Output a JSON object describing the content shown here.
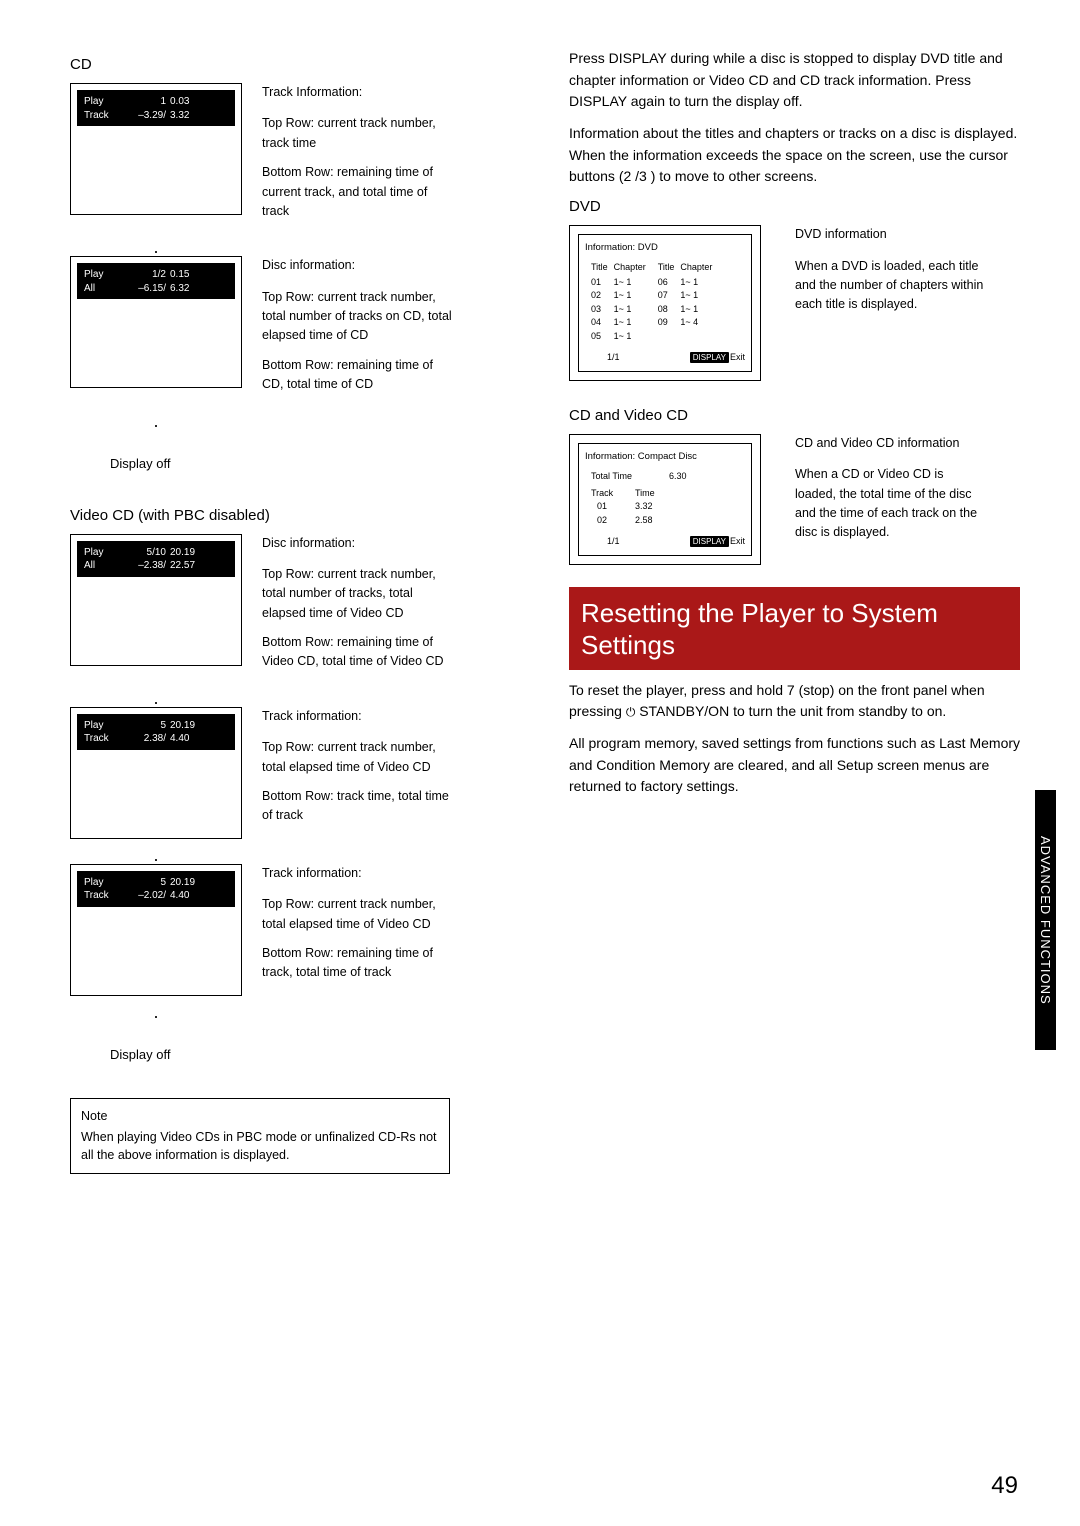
{
  "left": {
    "cd_label": "CD",
    "d1": {
      "row1": {
        "l": "Play",
        "m": "1",
        "r": "0.03"
      },
      "row2": {
        "l": "Track",
        "m": "–3.29/",
        "r": "3.32"
      },
      "title": "Track Information:",
      "top_label": "Top Row:",
      "top_text": "current track number, track time",
      "bot_label": "Bottom Row:",
      "bot_text": "remaining time of current track, and total time of track"
    },
    "d2": {
      "row1": {
        "l": "Play",
        "m": "1/2",
        "r": "0.15"
      },
      "row2": {
        "l": "All",
        "m": "–6.15/",
        "r": "6.32"
      },
      "title": "Disc information:",
      "top_label": "Top Row:",
      "top_text": "current track number, total number of tracks on CD, total elapsed time of CD",
      "bot_label": "Bottom Row:",
      "bot_text": "remaining time of CD, total time of CD"
    },
    "display_off": "Display off",
    "vcd_label": "Video CD (with PBC disabled)",
    "d3": {
      "row1": {
        "l": "Play",
        "m": "5/10",
        "r": "20.19"
      },
      "row2": {
        "l": "All",
        "m": "–2.38/",
        "r": "22.57"
      },
      "title": "Disc information:",
      "top_label": "Top Row:",
      "top_text": "current track number, total number of tracks, total elapsed time of Video CD",
      "bot_label": "Bottom Row:",
      "bot_text": "remaining time of Video CD, total time of Video CD"
    },
    "d4": {
      "row1": {
        "l": "Play",
        "m": "5",
        "r": "20.19"
      },
      "row2": {
        "l": "Track",
        "m": "2.38/",
        "r": "4.40"
      },
      "title": "Track information:",
      "top_label": "Top Row:",
      "top_text": "current track number, total elapsed time of Video CD",
      "bot_label": "Bottom Row:",
      "bot_text": "track time, total time of track"
    },
    "d5": {
      "row1": {
        "l": "Play",
        "m": "5",
        "r": "20.19"
      },
      "row2": {
        "l": "Track",
        "m": "–2.02/",
        "r": "4.40"
      },
      "title": "Track information:",
      "top_label": "Top Row:",
      "top_text": "current track number, total elapsed time of Video CD",
      "bot_label": "Bottom Row:",
      "bot_text": "remaining time of track, total time of track"
    },
    "note_title": "Note",
    "note_body": "When playing Video CDs in PBC mode or unfinalized CD-Rs not all the above information is displayed."
  },
  "right": {
    "p1": "Press DISPLAY during while a disc is stopped to display DVD title and chapter information or Video CD and CD track information. Press DISPLAY again to turn the display off.",
    "p2a": "Information about the titles and chapters or tracks on a disc is displayed. When the information exceeds the space on the screen, use the ",
    "p2b": "cursor buttons",
    "p2c": " (2 /3 ) to move to other screens.",
    "dvd_label": "DVD",
    "dvd_info": {
      "header": "Information: DVD",
      "cols": [
        "Title",
        "Chapter",
        "Title",
        "Chapter"
      ],
      "data_left_titles": [
        "01",
        "02",
        "03",
        "04",
        "05"
      ],
      "data_left_ch": [
        "1~ 1",
        "1~ 1",
        "1~ 1",
        "1~ 1",
        "1~ 1"
      ],
      "data_right_titles": [
        "06",
        "07",
        "08",
        "09"
      ],
      "data_right_ch": [
        "1~ 1",
        "1~ 1",
        "1~ 1",
        "1~ 4"
      ],
      "page": "1/1",
      "display_label": "DISPLAY",
      "exit_label": "Exit",
      "side_title": "DVD information",
      "side_body": "When a DVD is loaded, each title and the number of chapters within each title is displayed."
    },
    "cdvcd_label": "CD and Video CD",
    "cd_info": {
      "header": "Information: Compact Disc",
      "total_label": "Total Time",
      "total_value": "6.30",
      "track_label": "Track",
      "time_label": "Time",
      "tracks": [
        [
          "01",
          "3.32"
        ],
        [
          "02",
          "2.58"
        ]
      ],
      "page": "1/1",
      "display_label": "DISPLAY",
      "exit_label": "Exit",
      "side_title": "CD and Video CD information",
      "side_body": "When a CD or Video CD is loaded, the total time of the disc and the time of each track on the disc  is displayed."
    },
    "banner": "Resetting the Player to System Settings",
    "reset1a": "To reset the player, press and hold 7 (",
    "reset1b": "stop",
    "reset1c": ") on the front panel when pressing ",
    "reset1d": "STANDBY/ON",
    "reset1e": " to turn the unit from standby to on.",
    "reset2": "All program memory, saved settings from functions such as Last Memory and Condition Memory are cleared, and all Setup screen menus are returned to factory settings."
  },
  "sidetab": "ADVANCED  FUNCTIONS",
  "pageno": "49"
}
